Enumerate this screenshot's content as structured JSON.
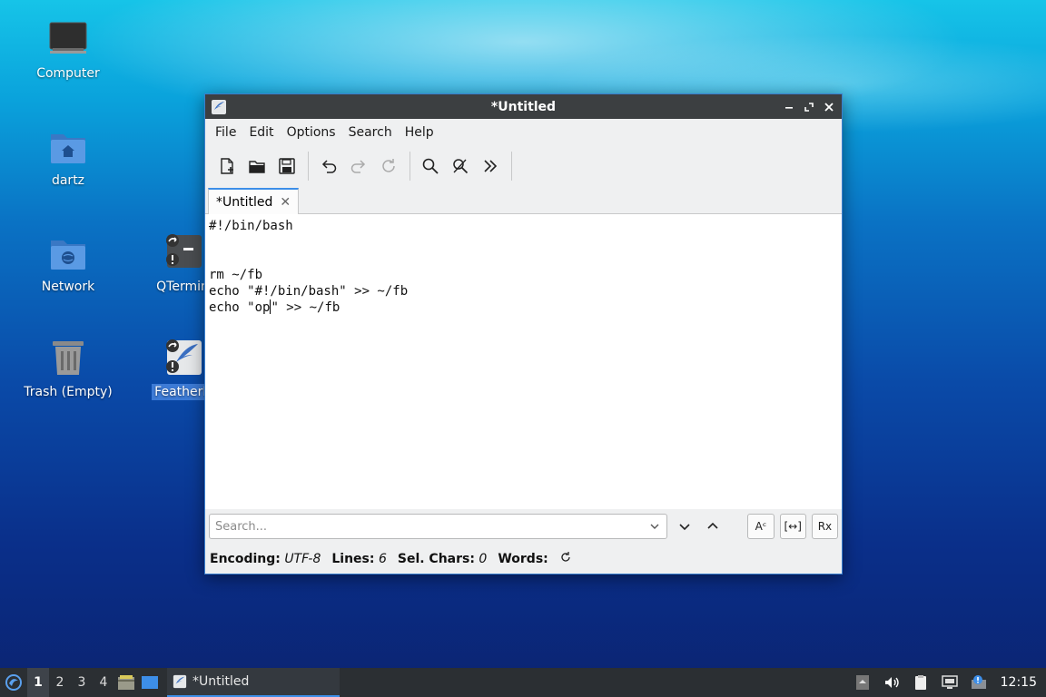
{
  "desktop": {
    "icons": [
      {
        "label": "Computer"
      },
      {
        "label": "dartz"
      },
      {
        "label": "Network"
      },
      {
        "label": "QTermin"
      },
      {
        "label": "Trash (Empty)"
      },
      {
        "label": "FeatherP"
      }
    ]
  },
  "window": {
    "title": "*Untitled",
    "menu": [
      "File",
      "Edit",
      "Options",
      "Search",
      "Help"
    ],
    "tab": {
      "label": "*Untitled",
      "close": "✕"
    },
    "editor": {
      "lines": [
        "#!/bin/bash",
        "",
        "",
        "rm ~/fb",
        "echo \"#!/bin/bash\" >> ~/fb",
        "echo \"op"
      ],
      "line6_after_caret": "\" >> ~/fb"
    },
    "search": {
      "placeholder": "Search...",
      "case_btn": "Aᶜ",
      "whole_btn": "[↔]",
      "regex_btn": "Rx"
    },
    "status": {
      "encoding_label": "Encoding:",
      "encoding_value": "UTF-8",
      "lines_label": "Lines:",
      "lines_value": "6",
      "sel_label": "Sel. Chars:",
      "sel_value": "0",
      "words_label": "Words:"
    }
  },
  "taskbar": {
    "workspaces": [
      "1",
      "2",
      "3",
      "4"
    ],
    "active_workspace": "1",
    "task_label": "*Untitled",
    "clock": "12:15"
  },
  "colors": {
    "accent": "#3d8ee8",
    "titlebar": "#3c3f41",
    "taskbar": "#2b2f33",
    "folder": "#4a8fd8"
  }
}
